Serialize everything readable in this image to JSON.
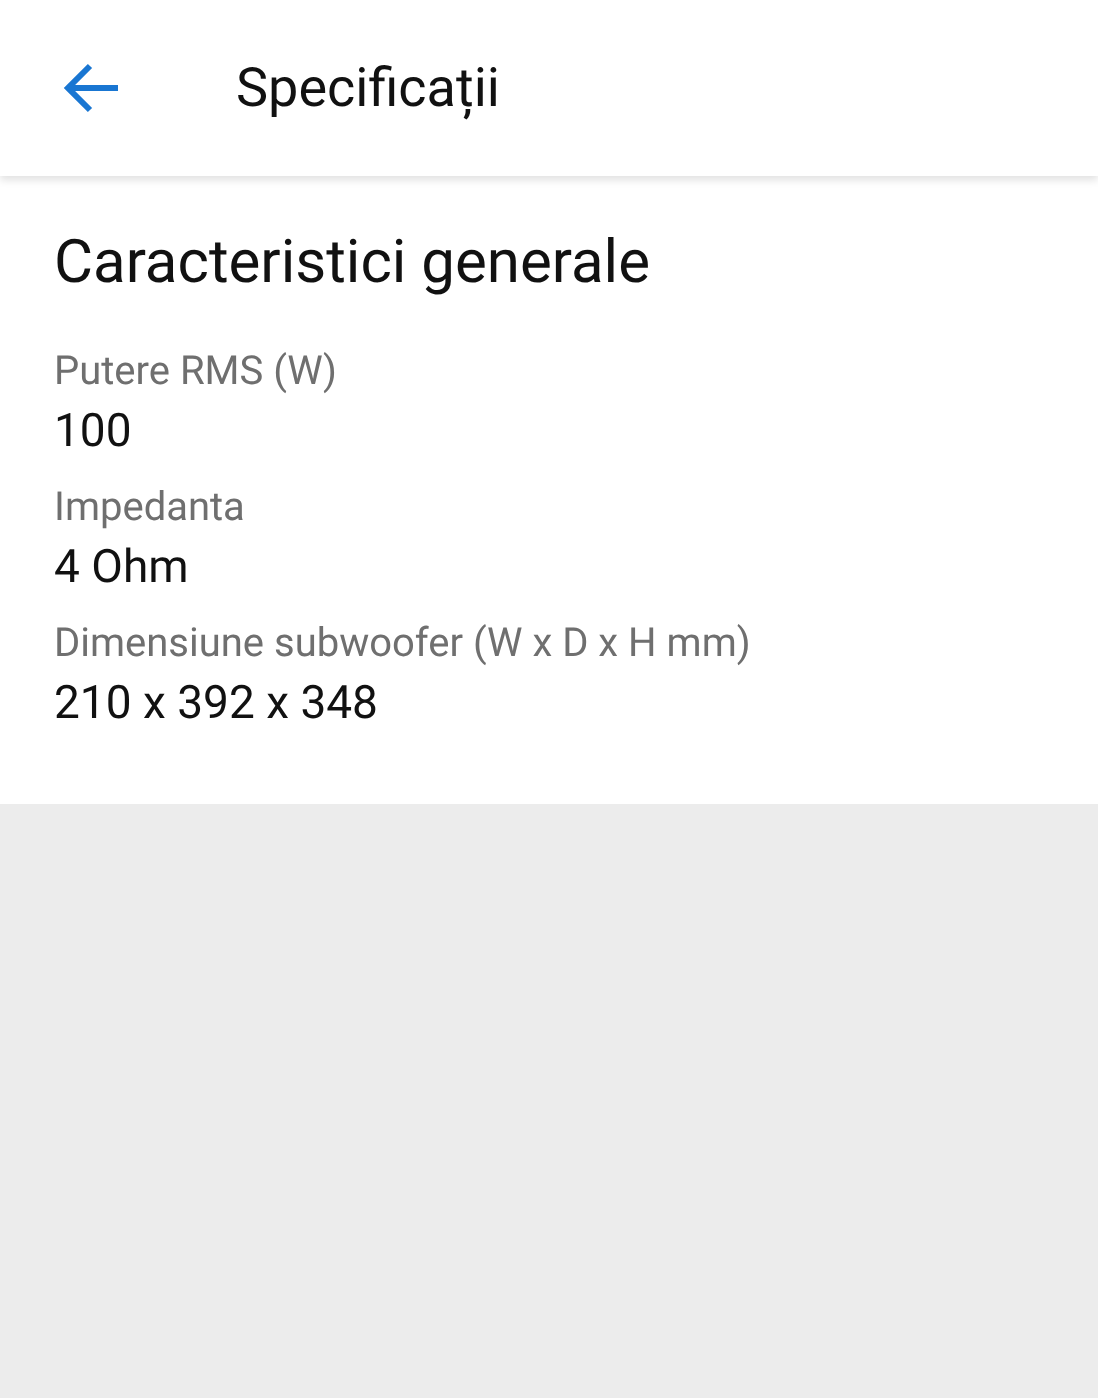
{
  "header": {
    "title": "Specificații"
  },
  "section": {
    "title": "Caracteristici generale",
    "specs": [
      {
        "label": "Putere RMS (W)",
        "value": "100"
      },
      {
        "label": "Impedanta",
        "value": "4 Ohm"
      },
      {
        "label": "Dimensiune subwoofer (W x D x H mm)",
        "value": "210 x 392 x 348"
      }
    ]
  }
}
